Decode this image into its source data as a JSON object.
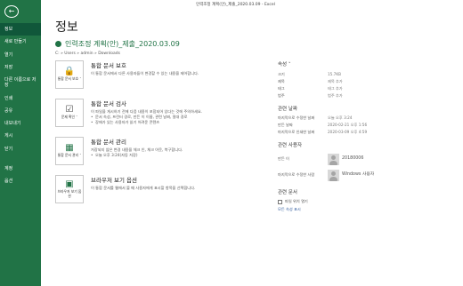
{
  "window": {
    "title": "인력조정 계획(안)_제출_2020.03.09  -  Excel"
  },
  "sidebar": {
    "back_icon": "back-arrow-icon",
    "items_top": [
      {
        "label": "정보",
        "active": true
      },
      {
        "label": "새로 만들기"
      },
      {
        "label": "열기"
      },
      {
        "label": "저장"
      },
      {
        "label": "다른 이름으로 저장"
      },
      {
        "label": "인쇄"
      },
      {
        "label": "공유"
      },
      {
        "label": "내보내기"
      },
      {
        "label": "게시"
      },
      {
        "label": "닫기"
      }
    ],
    "items_bottom": [
      {
        "label": "계정"
      },
      {
        "label": "옵션"
      }
    ]
  },
  "main": {
    "title": "정보",
    "file_name": "인력조정 계획(안)_제출_2020.03.09",
    "path": "C: » Users » admin » Downloads"
  },
  "sections": {
    "protect": {
      "icon": "lock-icon",
      "button_label": "통합 문서 보호 ˅",
      "title": "통합 문서 보호",
      "desc": "이 통합 문서에서 다른 사용자들이 변경할 수 있는 내용을 제어합니다."
    },
    "inspect": {
      "icon": "check-document-icon",
      "button_label": "문제 확인 ˅",
      "title": "통합 문서 검사",
      "desc": "이 파일을 게시하기 전에 다음 내용이 포함되어 있다는 것에 주의하세요.",
      "bullets": [
        "문서 속성, 프린터 경로, 만든 이 이름, 관련 날짜, 절대 경로",
        "장애가 있는 사용자가 읽기 어려운 콘텐츠"
      ]
    },
    "manage": {
      "icon": "manage-workbook-icon",
      "button_label": "통합 문서 관리 ˅",
      "title": "통합 문서 관리",
      "desc": "저장되지 않은 변경 내용을 체크 인, 체크 아웃, 복구합니다.",
      "bullets": [
        "오늘 오후 3:24(자동 저장)"
      ]
    },
    "browser": {
      "icon": "browser-view-icon",
      "button_label": "브라우저 보기 옵션",
      "title": "브라우저 보기 옵션",
      "desc": "이 통합 문서를 웹에서 볼 때 사용자에게 표시할 항목을 선택합니다."
    }
  },
  "properties": {
    "title": "속성 ˅",
    "rows": [
      {
        "key": "크기",
        "value": "15.7KB"
      },
      {
        "key": "제목",
        "value": "제목 추가"
      },
      {
        "key": "태그",
        "value": "태그 추가"
      },
      {
        "key": "범주",
        "value": "범주 추가"
      }
    ],
    "dates_title": "관련 날짜",
    "dates": [
      {
        "key": "마지막으로 수정한 날짜",
        "value": "오늘 오후 3:24"
      },
      {
        "key": "만든 날짜",
        "value": "2020-02-21 오후 1:56"
      },
      {
        "key": "마지막으로 인쇄한 날짜",
        "value": "2020-03-09 오후 4:59"
      }
    ],
    "people_title": "관련 사용자",
    "author_key": "만든 이",
    "author_name": "20180006",
    "modifier_key": "마지막으로 수정한 사람",
    "modifier_name": "Windows 사용자",
    "docs_title": "관련 문서",
    "open_location_label": "파일 위치 열기",
    "show_all_label": "모든 속성 표시"
  }
}
